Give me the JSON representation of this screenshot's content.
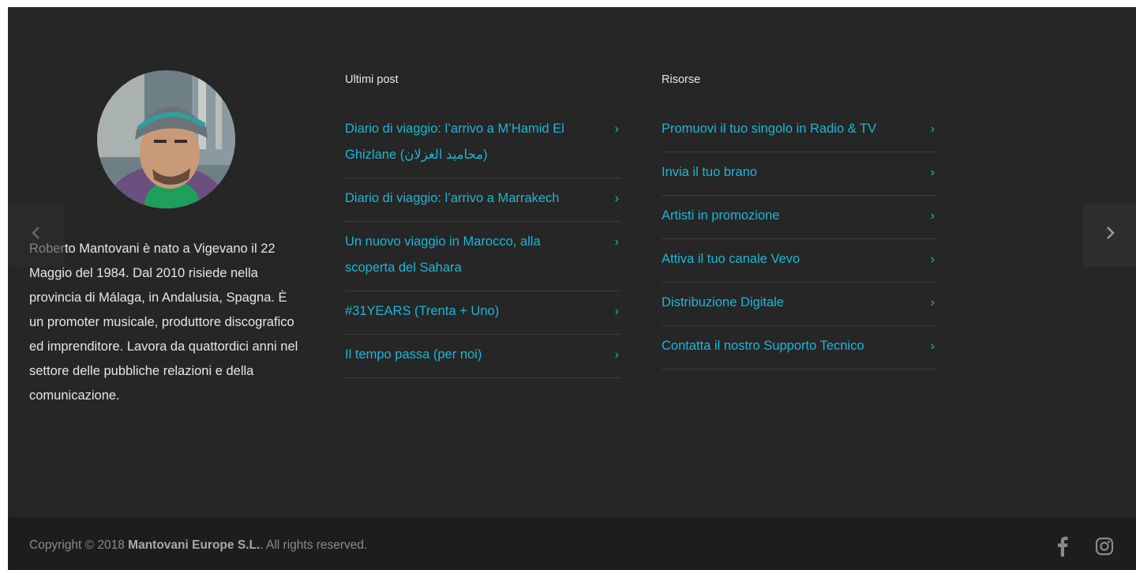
{
  "author": {
    "photo_alt": "Roberto Mantovani",
    "bio": "Roberto Mantovani è nato a Vigevano il 22 Maggio del 1984. Dal 2010 risiede nella provincia di Málaga, in Andalusia, Spagna. È un promoter musicale, produttore discografico ed imprenditore. Lavora da quattordici anni nel settore delle pubbliche relazioni e della comunicazione."
  },
  "posts": {
    "title": "Ultimi post",
    "items": [
      {
        "label": "Diario di viaggio: l’arrivo a M’Hamid El Ghizlane (محاميد الغزلان)"
      },
      {
        "label": "Diario di viaggio: l’arrivo a Marrakech"
      },
      {
        "label": "Un nuovo viaggio in Marocco, alla scoperta del Sahara"
      },
      {
        "label": "#31YEARS (Trenta + Uno)"
      },
      {
        "label": "Il tempo passa (per noi)"
      }
    ]
  },
  "resources": {
    "title": "Risorse",
    "items": [
      {
        "label": "Promuovi il tuo singolo in Radio & TV"
      },
      {
        "label": "Invia il tuo brano"
      },
      {
        "label": "Artisti in promozione"
      },
      {
        "label": "Attiva il tuo canale Vevo"
      },
      {
        "label": "Distribuzione Digitale"
      },
      {
        "label": "Contatta il nostro Supporto Tecnico"
      }
    ]
  },
  "carousel": {
    "prev_icon": "chevron-left-icon",
    "next_icon": "chevron-right-icon"
  },
  "footer": {
    "copyright_prefix": "Copyright © 2018 ",
    "company": "Mantovani Europe S.L.",
    "copyright_suffix": ". All rights reserved.",
    "social": [
      "facebook-icon",
      "instagram-icon"
    ]
  },
  "colors": {
    "link": "#1bb6d6",
    "background": "#262626",
    "footer_bar": "#1d1d1d"
  }
}
